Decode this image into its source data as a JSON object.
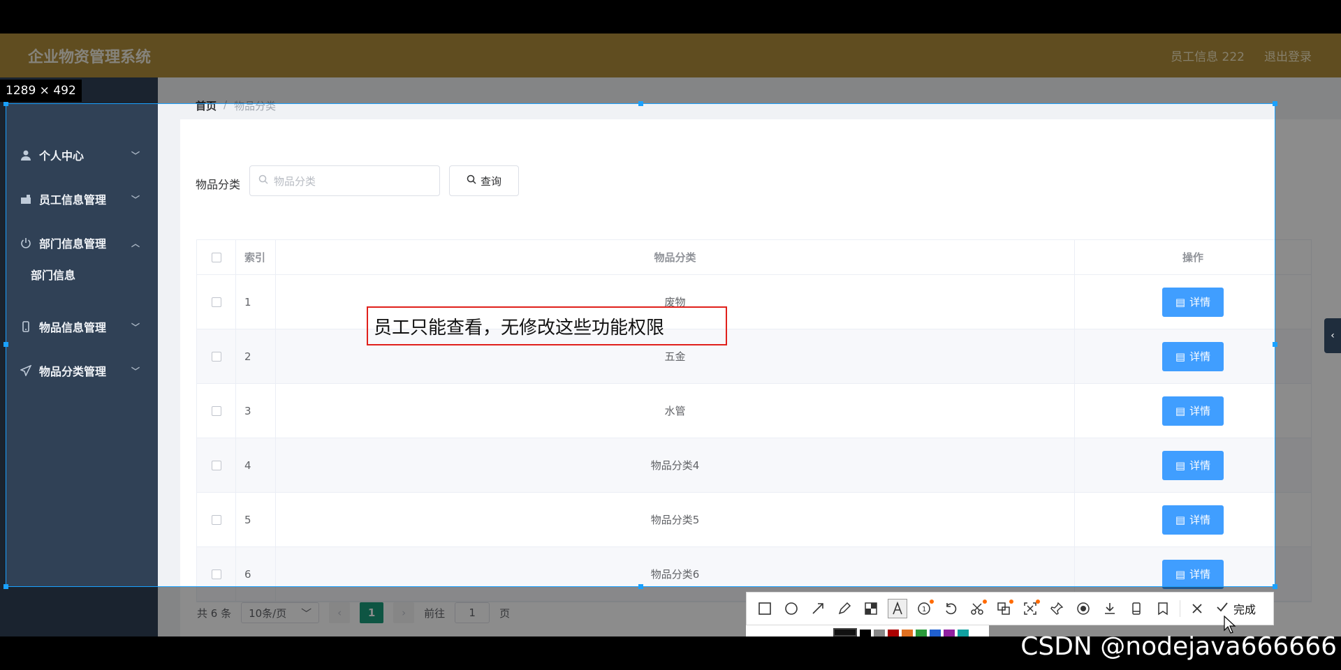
{
  "header": {
    "title": "企业物资管理系统",
    "user": "员工信息 222",
    "logout": "退出登录"
  },
  "sidebar": {
    "items": [
      {
        "label": "个人中心",
        "icon": "user-icon"
      },
      {
        "label": "员工信息管理",
        "icon": "employee-icon"
      },
      {
        "label": "部门信息管理",
        "icon": "power-icon"
      },
      {
        "label": "物品信息管理",
        "icon": "phone-icon"
      },
      {
        "label": "物品分类管理",
        "icon": "send-icon"
      }
    ],
    "sub_item": "部门信息"
  },
  "breadcrumb": {
    "home": "首页",
    "sep": "/",
    "current": "物品分类"
  },
  "search": {
    "label": "物品分类",
    "placeholder": "物品分类",
    "button": "查询"
  },
  "table": {
    "headers": [
      "索引",
      "物品分类",
      "操作"
    ],
    "rows": [
      {
        "index": "1",
        "category": "废物"
      },
      {
        "index": "2",
        "category": "五金"
      },
      {
        "index": "3",
        "category": "水管"
      },
      {
        "index": "4",
        "category": "物品分类4"
      },
      {
        "index": "5",
        "category": "物品分类5"
      },
      {
        "index": "6",
        "category": "物品分类6"
      }
    ],
    "detail_label": "详情"
  },
  "pager": {
    "total": "共 6 条",
    "page_size": "10条/页",
    "current": "1",
    "goto_prefix": "前往",
    "goto_value": "1",
    "goto_suffix": "页"
  },
  "capture": {
    "size_label": "1289 × 492",
    "annotation": "员工只能查看，无修改这些功能权限",
    "done": "完成"
  },
  "watermark": "CSDN @nodejava666666",
  "colors": {
    "topbar": "#b08d3b",
    "sidebar": "#304156",
    "primary": "#409eff",
    "pager_active": "#1a9c7b",
    "annotation_border": "#e0201b",
    "selection": "#1aa1ff"
  }
}
